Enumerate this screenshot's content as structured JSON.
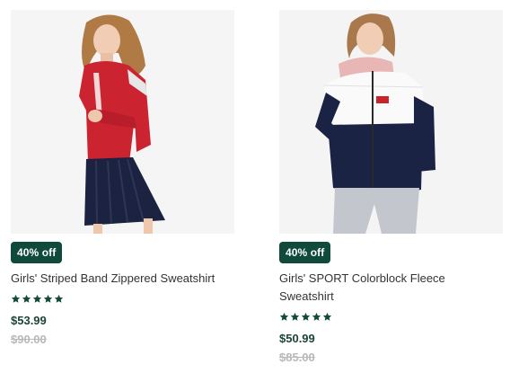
{
  "colors": {
    "badge_bg": "#0f4a3a",
    "star": "#0f4a3a",
    "price": "#1c4536",
    "was_price": "#b8b8b8",
    "name": "#333333"
  },
  "products": [
    {
      "image": "girl-red-striped-sweatshirt-photo",
      "badge": "40% off",
      "name": "Girls' Striped Band Zippered Sweatshirt",
      "rating": 5,
      "price": "$53.99",
      "was_price": "$90.00"
    },
    {
      "image": "girl-navy-white-colorblock-fleece-photo",
      "badge": "40% off",
      "name": "Girls' SPORT Colorblock Fleece Sweatshirt",
      "rating": 5,
      "price": "$50.99",
      "was_price": "$85.00"
    }
  ]
}
